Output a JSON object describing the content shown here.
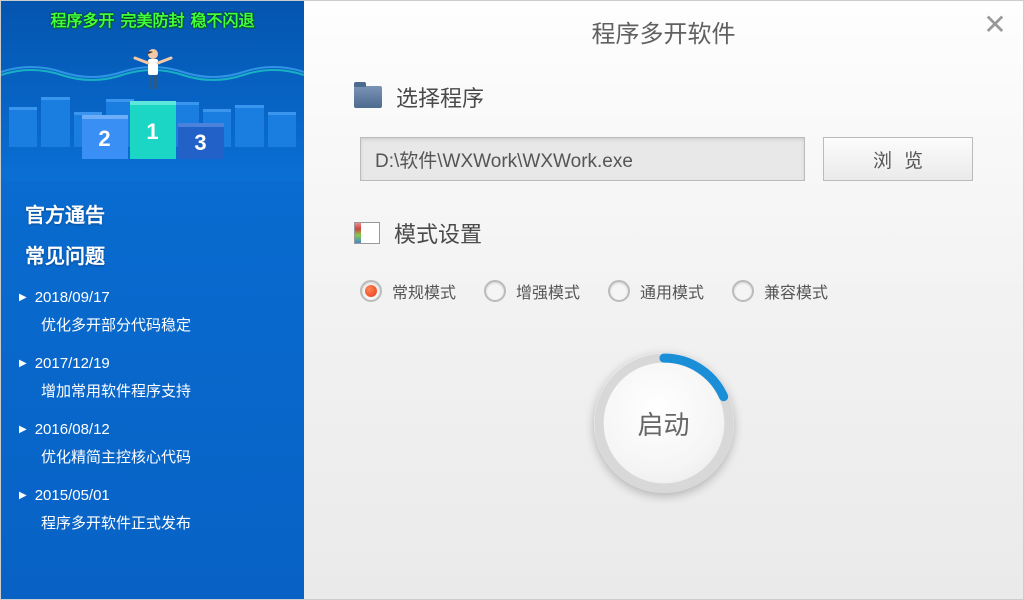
{
  "banner": {
    "tags": [
      "程序多开",
      "完美防封",
      "稳不闪退"
    ],
    "podium": [
      "1",
      "2",
      "3"
    ]
  },
  "sidebar": {
    "section1_title": "官方通告",
    "section2_title": "常见问题",
    "news": [
      {
        "date": "2018/09/17",
        "text": "优化多开部分代码稳定"
      },
      {
        "date": "2017/12/19",
        "text": "增加常用软件程序支持"
      },
      {
        "date": "2016/08/12",
        "text": "优化精简主控核心代码"
      },
      {
        "date": "2015/05/01",
        "text": "程序多开软件正式发布"
      }
    ]
  },
  "main": {
    "title": "程序多开软件",
    "select_label": "选择程序",
    "path_value": "D:\\软件\\WXWork\\WXWork.exe",
    "browse_label": "浏览",
    "mode_label": "模式设置",
    "modes": [
      "常规模式",
      "增强模式",
      "通用模式",
      "兼容模式"
    ],
    "selected_mode": 0,
    "launch_label": "启动"
  }
}
